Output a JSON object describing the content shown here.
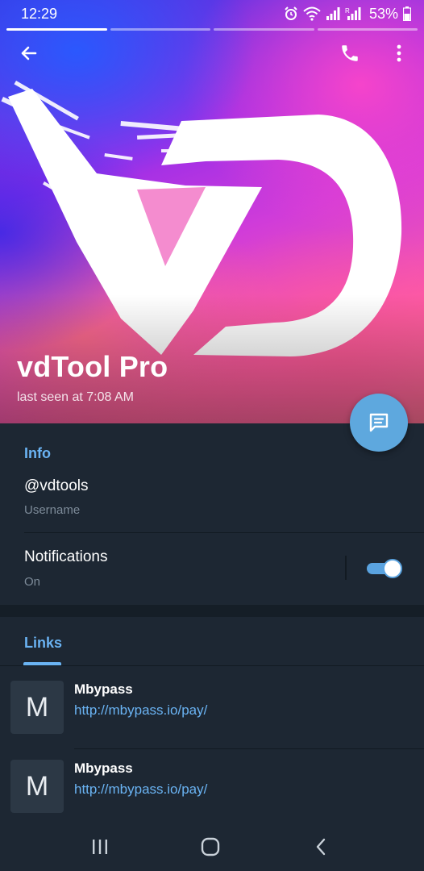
{
  "status_bar": {
    "time": "12:29",
    "battery_percent": "53%",
    "icons": [
      "alarm-icon",
      "wifi-icon",
      "signal-icon",
      "signal-r-icon",
      "battery-icon"
    ]
  },
  "stories": {
    "count": 4,
    "active_index": 0
  },
  "toolbar": {
    "icons": [
      "back-arrow-icon",
      "phone-icon",
      "more-vert-icon"
    ]
  },
  "profile": {
    "name": "vdTool Pro",
    "last_seen": "last seen at 7:08 AM",
    "logo_text": "VD"
  },
  "fab": {
    "icon": "message-icon"
  },
  "info": {
    "section_title": "Info",
    "username_value": "@vdtools",
    "username_label": "Username",
    "notifications_title": "Notifications",
    "notifications_value": "On",
    "notifications_enabled": true
  },
  "links": {
    "tab_label": "Links",
    "items": [
      {
        "thumb_letter": "M",
        "title": "Mbypass",
        "url": "http://mbypass.io/pay/"
      },
      {
        "thumb_letter": "M",
        "title": "Mbypass",
        "url": "http://mbypass.io/pay/"
      }
    ]
  },
  "nav_bar": {
    "icons": [
      "recents-icon",
      "home-icon",
      "back-icon"
    ]
  },
  "colors": {
    "background": "#1d2733",
    "accent": "#6ab3f3",
    "fab": "#5ea8de",
    "secondary_text": "#7d8b99"
  }
}
